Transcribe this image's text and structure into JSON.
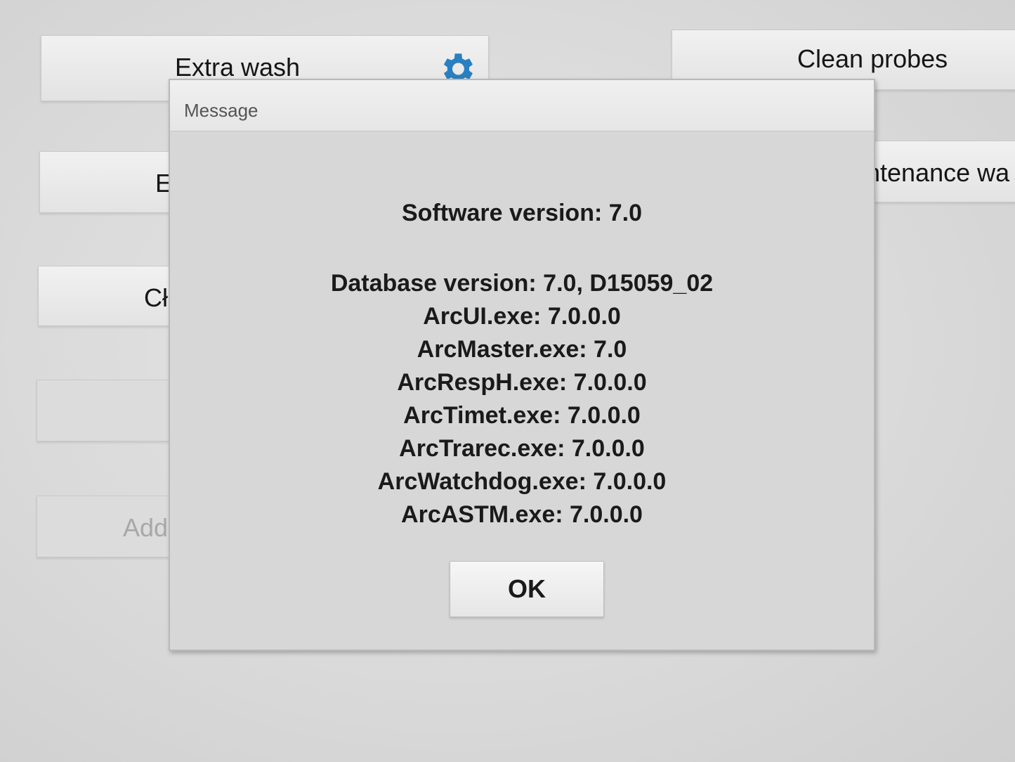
{
  "background_buttons": {
    "extra_wash": "Extra wash",
    "clean_probes": "Clean probes",
    "left_2_partial": "E",
    "maintenance_partial": "intenance wa",
    "left_3_partial": "Cł",
    "left_4_partial": "",
    "left_5_partial": "Add"
  },
  "icons": {
    "extra_wash_settings": "gear-icon"
  },
  "colors": {
    "gear_icon": "#2a7fc0",
    "dialog_background": "#d7d7d7"
  },
  "dialog": {
    "title": "Message",
    "software_version": "Software version: 7.0",
    "versions": [
      "Database version: 7.0, D15059_02",
      "ArcUI.exe: 7.0.0.0",
      "ArcMaster.exe: 7.0",
      "ArcRespH.exe: 7.0.0.0",
      "ArcTimet.exe: 7.0.0.0",
      "ArcTrarec.exe: 7.0.0.0",
      "ArcWatchdog.exe: 7.0.0.0",
      "ArcASTM.exe: 7.0.0.0"
    ],
    "ok_label": "OK"
  }
}
